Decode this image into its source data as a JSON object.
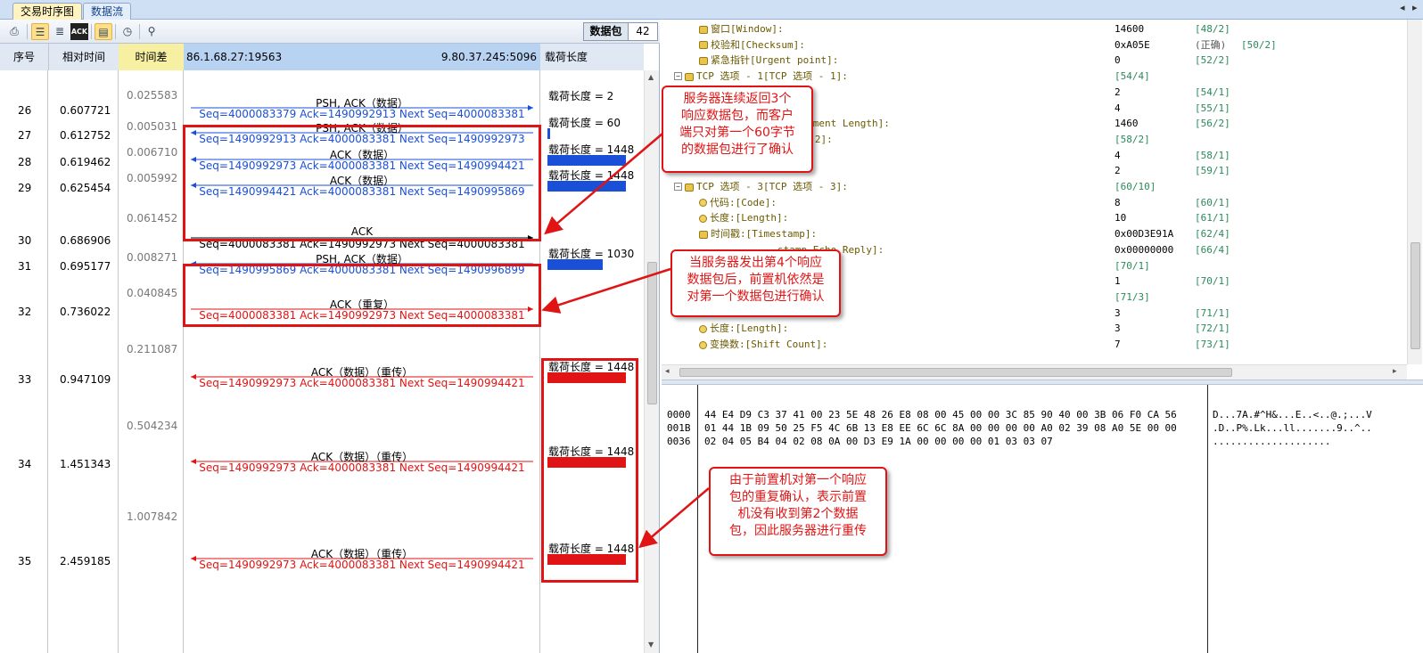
{
  "tabs": [
    {
      "label": "交易时序图",
      "active": true
    },
    {
      "label": "数据流",
      "active": false
    }
  ],
  "toolbar": {
    "packet_label": "数据包",
    "packet_count": "42"
  },
  "columns": {
    "seq": "序号",
    "rel_time": "相对时间",
    "diff": "时间差",
    "src": "86.1.68.27:19563",
    "dst": "9.80.37.245:5096",
    "payload": "载荷长度"
  },
  "diffs": [
    "0.025583",
    "0.005031",
    "0.006710",
    "0.005992",
    "0.061452",
    "0.008271",
    "0.040845",
    "0.211087",
    "0.504234",
    "1.007842"
  ],
  "rows": [
    {
      "seq": "26",
      "time": "0.607721",
      "title": "PSH, ACK（数据）",
      "detail": "Seq=4000083379  Ack=1490992913  Next Seq=4000083381",
      "len": "载荷长度 = 2"
    },
    {
      "seq": "27",
      "time": "0.612752",
      "title": "PSH, ACK（数据）",
      "detail": "Seq=1490992913  Ack=4000083381  Next Seq=1490992973",
      "len": "载荷长度 = 60"
    },
    {
      "seq": "28",
      "time": "0.619462",
      "title": "ACK（数据）",
      "detail": "Seq=1490992973  Ack=4000083381  Next Seq=1490994421",
      "len": "载荷长度 = 1448"
    },
    {
      "seq": "29",
      "time": "0.625454",
      "title": "ACK（数据）",
      "detail": "Seq=1490994421  Ack=4000083381  Next Seq=1490995869",
      "len": "载荷长度 = 1448"
    },
    {
      "seq": "30",
      "time": "0.686906",
      "title": "ACK",
      "detail": "Seq=4000083381  Ack=1490992973  Next Seq=4000083381",
      "len": ""
    },
    {
      "seq": "31",
      "time": "0.695177",
      "title": "PSH, ACK（数据）",
      "detail": "Seq=1490995869  Ack=4000083381  Next Seq=1490996899",
      "len": "载荷长度 = 1030"
    },
    {
      "seq": "32",
      "time": "0.736022",
      "title": "ACK（重复）",
      "detail": "Seq=4000083381  Ack=1490992973  Next Seq=4000083381",
      "len": ""
    },
    {
      "seq": "33",
      "time": "0.947109",
      "title": "ACK（数据）（重传）",
      "detail": "Seq=1490992973  Ack=4000083381  Next Seq=1490994421",
      "len": "载荷长度 = 1448"
    },
    {
      "seq": "34",
      "time": "1.451343",
      "title": "ACK（数据）（重传）",
      "detail": "Seq=1490992973  Ack=4000083381  Next Seq=1490994421",
      "len": "载荷长度 = 1448"
    },
    {
      "seq": "35",
      "time": "2.459185",
      "title": "ACK（数据）（重传）",
      "detail": "Seq=1490992973  Ack=4000083381  Next Seq=1490994421",
      "len": "载荷长度 = 1448"
    }
  ],
  "tree": [
    {
      "name": "窗口[Window]:",
      "value": "14600",
      "offset": "[48/2]"
    },
    {
      "name": "校验和[Checksum]:",
      "value": "0xA05E",
      "extra": "(正确)",
      "offset2": "[50/2]"
    },
    {
      "name": "紧急指针[Urgent point]:",
      "value": "0",
      "offset": "[52/2]"
    },
    {
      "name": "TCP 选项 - 1[TCP 选项 - 1]:",
      "value": "",
      "offset_at_value": "[54/4]"
    },
    {
      "name": "",
      "value": "2",
      "offset": "[54/1]"
    },
    {
      "name": "",
      "value": "4",
      "offset": "[55/1]"
    },
    {
      "name": "um Segment Length]:",
      "value": "1460",
      "offset": "[56/2]"
    },
    {
      "name": "选项 - 2]:",
      "value": "",
      "offset_at_value": "[58/2]"
    },
    {
      "name": "",
      "value": "4",
      "offset": "[58/1]"
    },
    {
      "name": "",
      "value": "2",
      "offset": "[59/1]"
    },
    {
      "name": "TCP 选项 - 3[TCP 选项 - 3]:",
      "value": "",
      "offset_at_value": "[60/10]"
    },
    {
      "name": "代码:[Code]:",
      "value": "8",
      "offset": "[60/1]"
    },
    {
      "name": "长度:[Length]:",
      "value": "10",
      "offset": "[61/1]"
    },
    {
      "name": "时间戳:[Timestamp]:",
      "value": "0x00D3E91A",
      "offset": "[62/4]"
    },
    {
      "name": "stamp Echo Reply]:",
      "value": "0x00000000",
      "offset": "[66/4]"
    },
    {
      "name": "4]:",
      "value": "",
      "offset_at_value": "[70/1]"
    },
    {
      "name": "",
      "value": "1",
      "offset": "[70/1]"
    },
    {
      "name": "5]:",
      "value": "",
      "offset_at_value": "[71/3]"
    },
    {
      "name": "",
      "value": "3",
      "offset": "[71/1]"
    },
    {
      "name": "长度:[Length]:",
      "value": "3",
      "offset": "[72/1]"
    },
    {
      "name": "变换数:[Shift Count]:",
      "value": "7",
      "offset": "[73/1]"
    }
  ],
  "hex": [
    {
      "offset": "0000",
      "bytes": "44 E4 D9 C3 37 41 00 23 5E 48 26 E8 08 00 45 00 00 3C 85 90 40 00 3B 06 F0 CA 56",
      "ascii": "D...7A.#^H&...E..<..@.;...V"
    },
    {
      "offset": "001B",
      "bytes": "01 44 1B 09 50 25 F5 4C 6B 13 E8 EE 6C 6C 8A 00 00 00 00 A0 02 39 08 A0 5E 00 00",
      "ascii": ".D..P%.Lk...ll.......9..^.."
    },
    {
      "offset": "0036",
      "bytes": "02 04 05 B4 04 02 08 0A 00 D3 E9 1A 00 00 00 00 01 03 03 07",
      "ascii": "...................."
    }
  ],
  "callouts": {
    "c1": [
      "服务器连续返回3个",
      "响应数据包，而客户",
      "端只对第一个60字节",
      "的数据包进行了确认"
    ],
    "c2": [
      "当服务器发出第4个响应",
      "数据包后，前置机依然是",
      "对第一个数据包进行确认"
    ],
    "c3": [
      "由于前置机对第一个响应",
      "包的重复确认，表示前置",
      "机没有收到第2个数据",
      "包，因此服务器进行重传"
    ]
  },
  "colors": {
    "blue": "#1a4fd8",
    "red": "#e01414",
    "header_yellow": "#f7f0a3",
    "header_blue": "#b8d2f2"
  }
}
